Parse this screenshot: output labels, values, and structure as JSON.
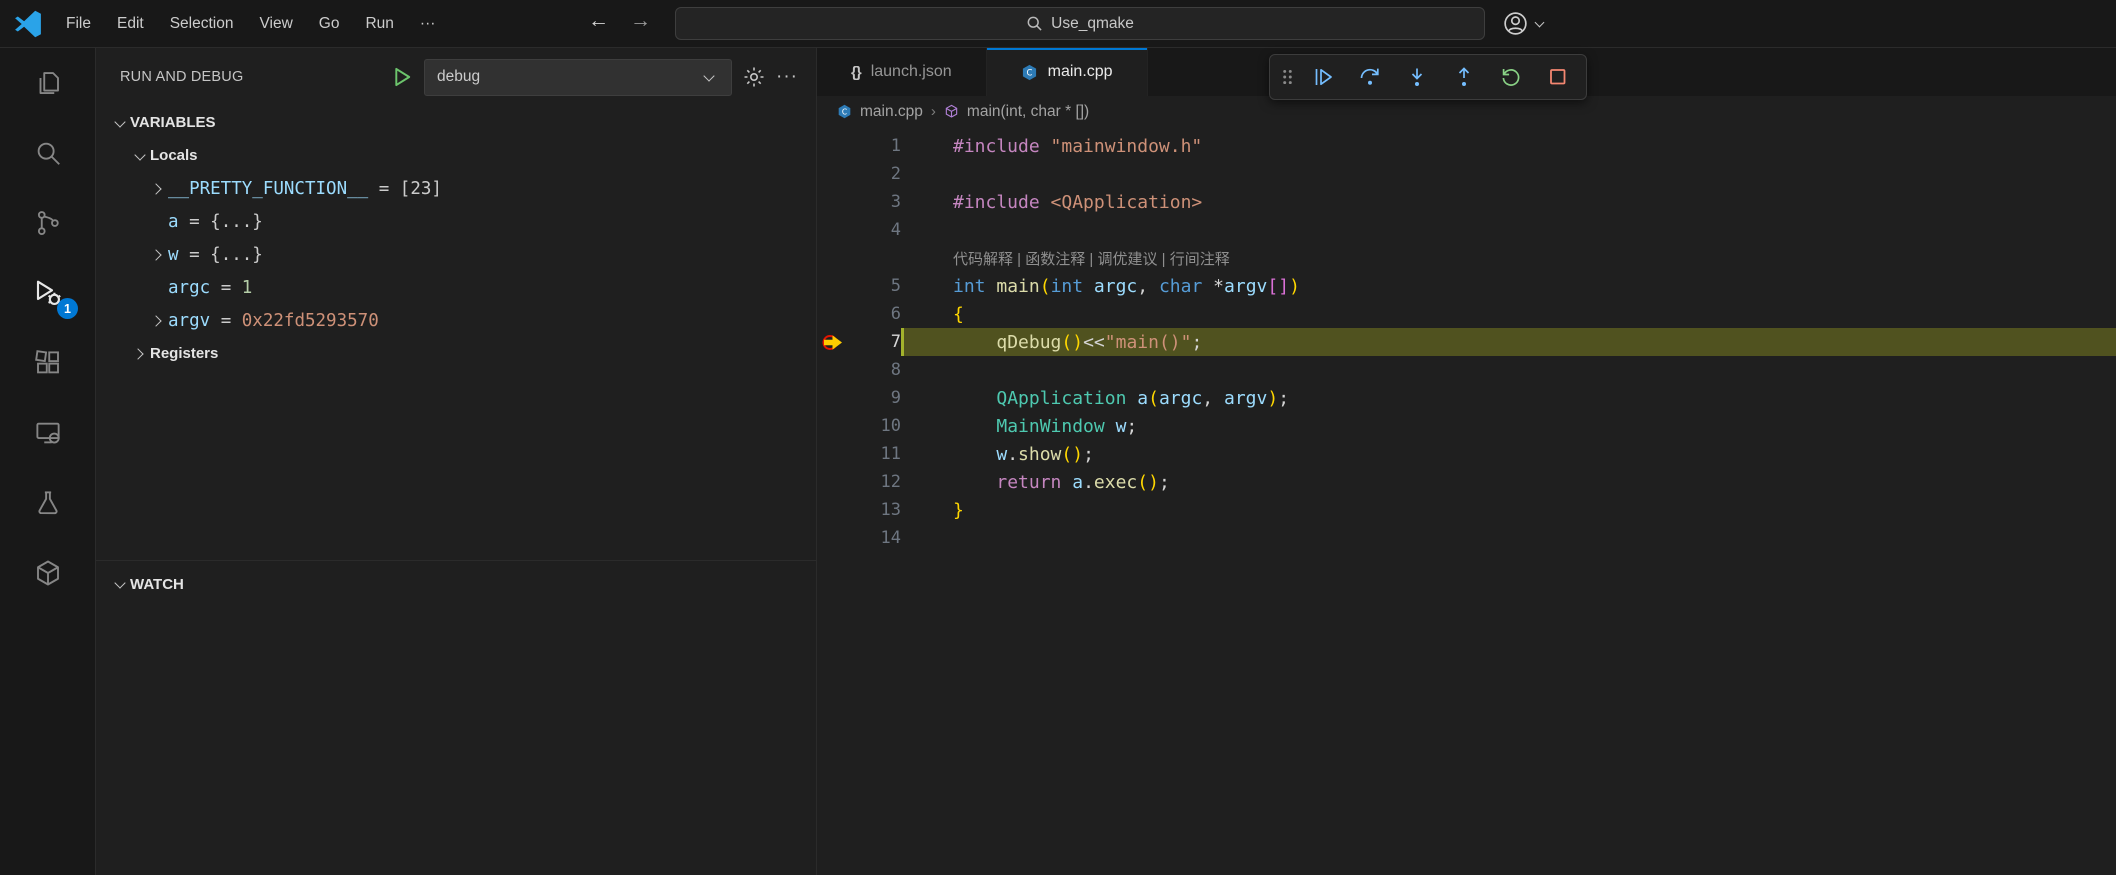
{
  "colors": {
    "accent_blue": "#0078d4",
    "current_line_highlight": "#50521f",
    "step_icon_blue": "#75beff",
    "restart_green": "#89d185",
    "stop_red": "#f48771",
    "badge_blue": "#0078d4"
  },
  "title_bar": {
    "menus": [
      "File",
      "Edit",
      "Selection",
      "View",
      "Go",
      "Run"
    ],
    "more_label": "···",
    "back_glyph": "←",
    "forward_glyph": "→",
    "search_text": "Use_qmake"
  },
  "activity_bar": {
    "items": [
      {
        "name": "explorer"
      },
      {
        "name": "search"
      },
      {
        "name": "source-control"
      },
      {
        "name": "run-and-debug",
        "active": true,
        "badge": "1"
      },
      {
        "name": "extensions"
      },
      {
        "name": "remote-explorer"
      },
      {
        "name": "testing"
      },
      {
        "name": "hexagon-extension"
      }
    ]
  },
  "sidebar": {
    "header_title": "RUN AND DEBUG",
    "config_name": "debug",
    "more_label": "···",
    "variables_label": "VARIABLES",
    "locals_label": "Locals",
    "registers_label": "Registers",
    "watch_label": "WATCH",
    "assign_separator": " = ",
    "variables": [
      {
        "name": "__PRETTY_FUNCTION__",
        "value": "[23]",
        "value_class": "val-plain",
        "expand": "right"
      },
      {
        "name": "a",
        "value": "{...}",
        "value_class": "val-plain",
        "expand": "none"
      },
      {
        "name": "w",
        "value": "{...}",
        "value_class": "val-plain",
        "expand": "right"
      },
      {
        "name": "argc",
        "value": "1",
        "value_class": "val-num",
        "expand": "none"
      },
      {
        "name": "argv",
        "value": "0x22fd5293570",
        "value_class": "val-str",
        "expand": "right"
      }
    ]
  },
  "debug_toolbar": {
    "buttons": [
      "drag-handle",
      "continue",
      "step-over",
      "step-into",
      "step-out",
      "restart",
      "stop"
    ]
  },
  "editor": {
    "tabs": [
      {
        "label": "launch.json",
        "icon": "json-braces",
        "icon_glyph": "{}",
        "active": false
      },
      {
        "label": "main.cpp",
        "icon": "cpp-file",
        "active": true
      }
    ],
    "breadcrumb": {
      "file": "main.cpp",
      "separator": "›",
      "symbol": "main(int, char * [])"
    },
    "lines": [
      {
        "num": "1",
        "tokens": [
          {
            "c": "pre",
            "t": "#include "
          },
          {
            "c": "str",
            "t": "\"mainwindow.h\""
          }
        ]
      },
      {
        "num": "2",
        "tokens": []
      },
      {
        "num": "3",
        "tokens": [
          {
            "c": "pre",
            "t": "#include "
          },
          {
            "c": "str",
            "t": "<QApplication>"
          }
        ]
      },
      {
        "num": "4",
        "tokens": []
      },
      {
        "num": "",
        "annotation": true,
        "tokens": [
          {
            "c": "ann",
            "t": "代码解释 | 函数注释 | 调优建议 | 行间注释"
          }
        ]
      },
      {
        "num": "5",
        "tokens": [
          {
            "c": "kw",
            "t": "int"
          },
          {
            "c": "pl",
            "t": " "
          },
          {
            "c": "fn",
            "t": "main"
          },
          {
            "c": "b1",
            "t": "("
          },
          {
            "c": "kw",
            "t": "int"
          },
          {
            "c": "pl",
            "t": " "
          },
          {
            "c": "var",
            "t": "argc"
          },
          {
            "c": "pl",
            "t": ", "
          },
          {
            "c": "kw",
            "t": "char"
          },
          {
            "c": "pl",
            "t": " *"
          },
          {
            "c": "var",
            "t": "argv"
          },
          {
            "c": "b2",
            "t": "[]"
          },
          {
            "c": "b1",
            "t": ")"
          }
        ]
      },
      {
        "num": "6",
        "tokens": [
          {
            "c": "b1",
            "t": "{"
          }
        ]
      },
      {
        "num": "7",
        "current": true,
        "tokens": [
          {
            "c": "pl",
            "t": "    "
          },
          {
            "c": "fn",
            "t": "qDebug"
          },
          {
            "c": "b1",
            "t": "()"
          },
          {
            "c": "pl",
            "t": "<<"
          },
          {
            "c": "str",
            "t": "\"main()\""
          },
          {
            "c": "pl",
            "t": ";"
          }
        ]
      },
      {
        "num": "8",
        "tokens": []
      },
      {
        "num": "9",
        "tokens": [
          {
            "c": "pl",
            "t": "    "
          },
          {
            "c": "type",
            "t": "QApplication"
          },
          {
            "c": "pl",
            "t": " "
          },
          {
            "c": "var",
            "t": "a"
          },
          {
            "c": "b1",
            "t": "("
          },
          {
            "c": "var",
            "t": "argc"
          },
          {
            "c": "pl",
            "t": ", "
          },
          {
            "c": "var",
            "t": "argv"
          },
          {
            "c": "b1",
            "t": ")"
          },
          {
            "c": "pl",
            "t": ";"
          }
        ]
      },
      {
        "num": "10",
        "tokens": [
          {
            "c": "pl",
            "t": "    "
          },
          {
            "c": "type",
            "t": "MainWindow"
          },
          {
            "c": "pl",
            "t": " "
          },
          {
            "c": "var",
            "t": "w"
          },
          {
            "c": "pl",
            "t": ";"
          }
        ]
      },
      {
        "num": "11",
        "tokens": [
          {
            "c": "pl",
            "t": "    "
          },
          {
            "c": "var",
            "t": "w"
          },
          {
            "c": "pl",
            "t": "."
          },
          {
            "c": "fn",
            "t": "show"
          },
          {
            "c": "b1",
            "t": "()"
          },
          {
            "c": "pl",
            "t": ";"
          }
        ]
      },
      {
        "num": "12",
        "tokens": [
          {
            "c": "pl",
            "t": "    "
          },
          {
            "c": "ctrl",
            "t": "return"
          },
          {
            "c": "pl",
            "t": " "
          },
          {
            "c": "var",
            "t": "a"
          },
          {
            "c": "pl",
            "t": "."
          },
          {
            "c": "fn",
            "t": "exec"
          },
          {
            "c": "b1",
            "t": "()"
          },
          {
            "c": "pl",
            "t": ";"
          }
        ]
      },
      {
        "num": "13",
        "tokens": [
          {
            "c": "b1",
            "t": "}"
          }
        ]
      },
      {
        "num": "14",
        "tokens": []
      }
    ]
  }
}
